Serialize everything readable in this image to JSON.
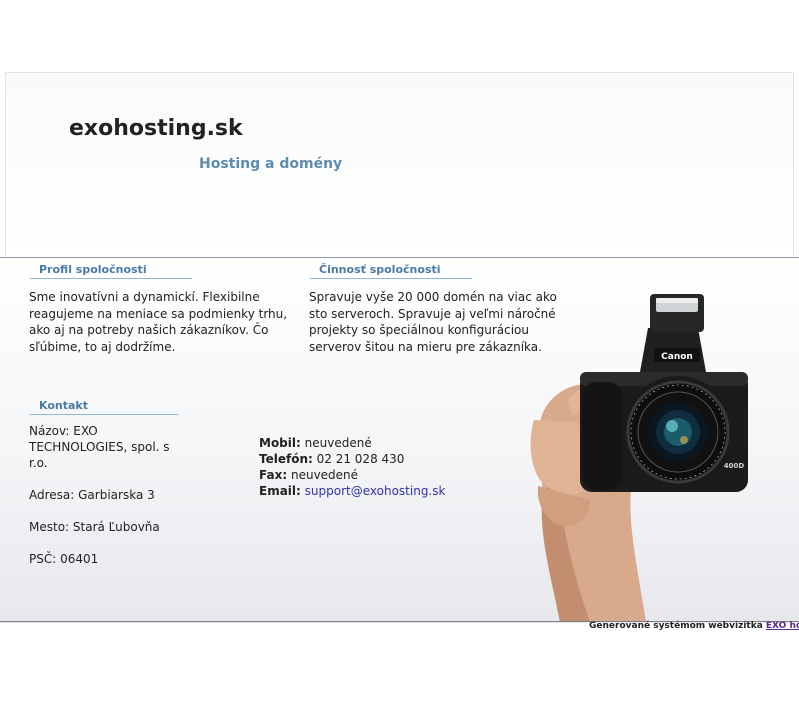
{
  "header": {
    "site_title": "exohosting.sk",
    "site_subtitle": "Hosting a domény"
  },
  "profile": {
    "heading": "Profil spoločnosti",
    "lines": [
      "Sme inovatívni a dynamickí. Flexibilne",
      "reagujeme na meniace sa podmienky trhu,",
      "ako aj na potreby našich zákazníkov. Čo",
      "sľúbime, to aj dodržíme."
    ]
  },
  "activity": {
    "heading": "Činnosť spoločnosti",
    "lines": [
      "Spravuje vyše 20 000 domén na viac ako",
      "sto serveroch. Spravuje aj veľmi náročné",
      "projekty so špeciálnou konfiguráciou",
      "serverov šitou na mieru pre zákazníka."
    ]
  },
  "contact": {
    "heading": "Kontakt",
    "name_lines": [
      "Názov: EXO",
      "TECHNOLOGIES, spol. s",
      "r.o."
    ],
    "address": "Adresa: Garbiarska 3",
    "city": "Mesto: Stará Ľubovňa",
    "zip": "PSČ: 06401",
    "mobile_label": "Mobil:",
    "mobile_value": "neuvedené",
    "phone_label": "Telefón:",
    "phone_value": "02 21 028 430",
    "fax_label": "Fax:",
    "fax_value": "neuvedené",
    "email_label": "Email:",
    "email_value": "support@exohosting.sk"
  },
  "footer": {
    "text": "Generované systémom webvizitka",
    "link": "EXO hosting"
  },
  "colors": {
    "heading_blue": "#4a7aa6",
    "subtitle_blue": "#5e8cb0",
    "link_blue": "#3333aa",
    "footer_link": "#5a2a8a"
  },
  "illustration": {
    "icon": "camera-in-hand-icon",
    "camera_brand": "Canon",
    "lens_text": "CANON ZOOM LENS EF-S 17-85mm",
    "model": "400D"
  }
}
